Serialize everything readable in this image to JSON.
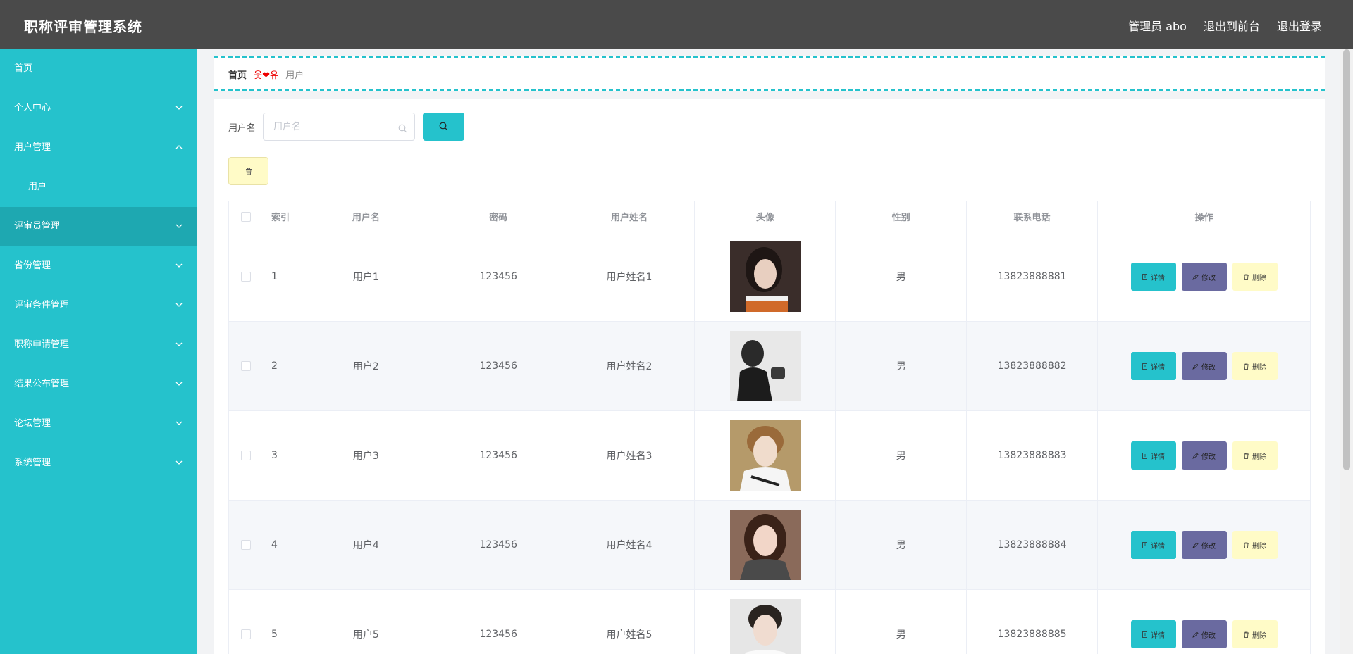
{
  "header": {
    "title": "职称评审管理系统",
    "admin_label": "管理员 abo",
    "front_label": "退出到前台",
    "logout_label": "退出登录"
  },
  "sidebar": {
    "items": [
      {
        "label": "首页"
      },
      {
        "label": "个人中心"
      },
      {
        "label": "用户管理"
      },
      {
        "label": "用户"
      },
      {
        "label": "评审员管理"
      },
      {
        "label": "省份管理"
      },
      {
        "label": "评审条件管理"
      },
      {
        "label": "职称申请管理"
      },
      {
        "label": "结果公布管理"
      },
      {
        "label": "论坛管理"
      },
      {
        "label": "系统管理"
      }
    ]
  },
  "breadcrumb": {
    "home": "首页",
    "separator": "웃❤유",
    "current": "用户"
  },
  "search": {
    "label": "用户名",
    "placeholder": "用户名",
    "value": ""
  },
  "table": {
    "headers": [
      "索引",
      "用户名",
      "密码",
      "用户姓名",
      "头像",
      "性别",
      "联系电话",
      "操作"
    ],
    "rows": [
      {
        "index": "1",
        "username": "用户1",
        "password": "123456",
        "name": "用户姓名1",
        "gender": "男",
        "phone": "13823888881"
      },
      {
        "index": "2",
        "username": "用户2",
        "password": "123456",
        "name": "用户姓名2",
        "gender": "男",
        "phone": "13823888882"
      },
      {
        "index": "3",
        "username": "用户3",
        "password": "123456",
        "name": "用户姓名3",
        "gender": "男",
        "phone": "13823888883"
      },
      {
        "index": "4",
        "username": "用户4",
        "password": "123456",
        "name": "用户姓名4",
        "gender": "男",
        "phone": "13823888884"
      },
      {
        "index": "5",
        "username": "用户5",
        "password": "123456",
        "name": "用户姓名5",
        "gender": "男",
        "phone": "13823888885"
      }
    ],
    "actions": {
      "detail": "详情",
      "edit": "修改",
      "delete": "删除"
    }
  },
  "colors": {
    "accent": "#25c2cc",
    "topbar": "#4a4a4a",
    "edit_button": "#6a6aa0",
    "delete_button": "#fffbc7"
  }
}
